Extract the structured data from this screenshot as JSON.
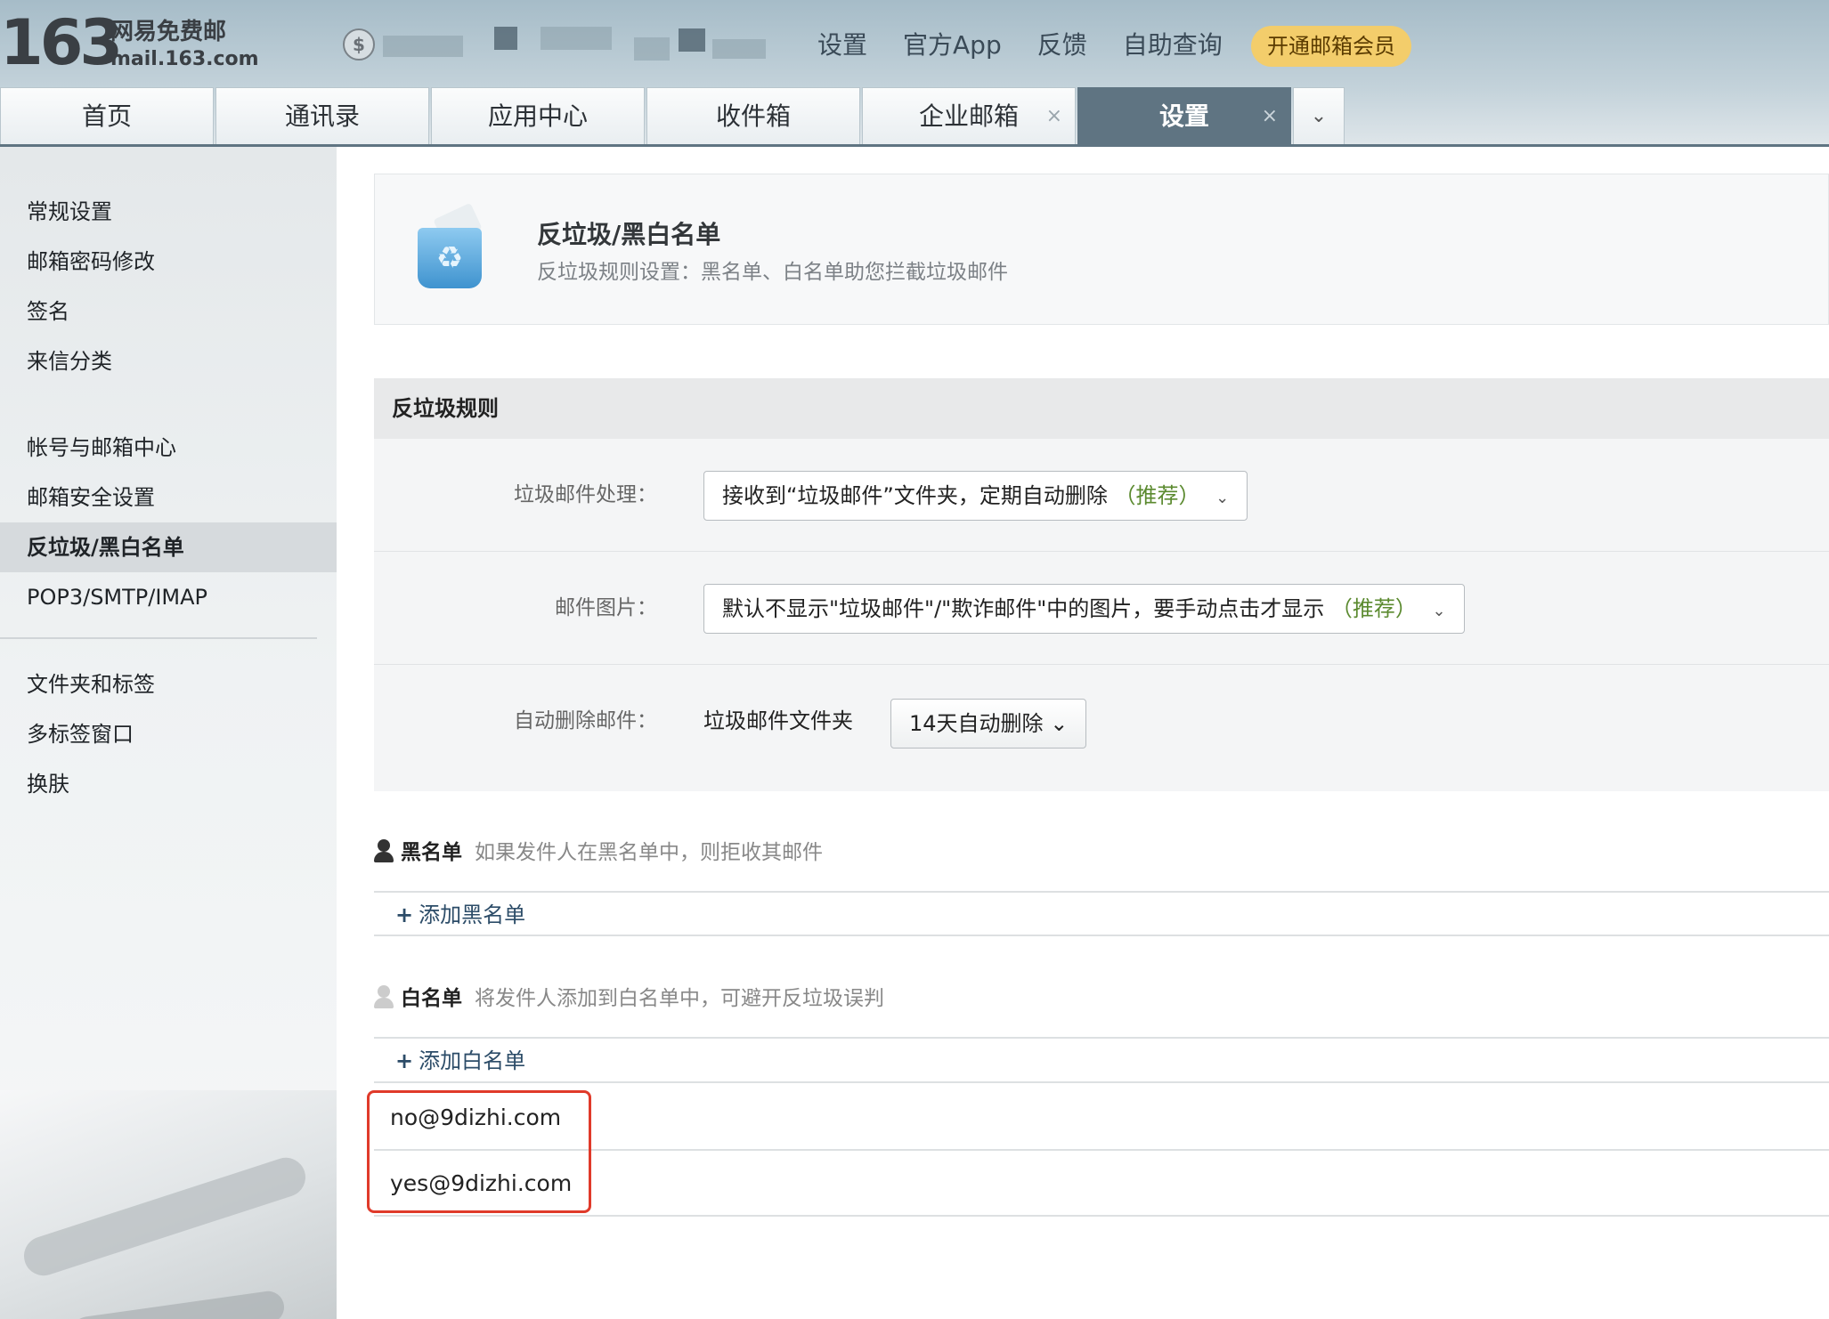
{
  "header": {
    "logo_number": "163",
    "logo_cn": "网易免费邮",
    "logo_en": "mail.163.com",
    "coin_symbol": "$",
    "links": [
      "设置",
      "官方App",
      "反馈",
      "自助查询"
    ],
    "vip_label": "开通邮箱会员"
  },
  "tabs": [
    {
      "label": "首页",
      "closable": false,
      "active": false
    },
    {
      "label": "通讯录",
      "closable": false,
      "active": false
    },
    {
      "label": "应用中心",
      "closable": false,
      "active": false
    },
    {
      "label": "收件箱",
      "closable": false,
      "active": false
    },
    {
      "label": "企业邮箱",
      "closable": true,
      "active": false
    },
    {
      "label": "设置",
      "closable": true,
      "active": true
    }
  ],
  "tab_close_symbol": "×",
  "tab_more_symbol": "⌄",
  "sidebar": {
    "items": [
      "常规设置",
      "邮箱密码修改",
      "签名",
      "来信分类",
      "帐号与邮箱中心",
      "邮箱安全设置",
      "反垃圾/黑白名单",
      "POP3/SMTP/IMAP",
      "文件夹和标签",
      "多标签窗口",
      "换肤"
    ],
    "active_index": 6
  },
  "banner": {
    "title": "反垃圾/黑白名单",
    "subtitle": "反垃圾规则设置：黑名单、白名单助您拦截垃圾邮件",
    "icon_symbol": "♻"
  },
  "rules": {
    "section_title": "反垃圾规则",
    "spam": {
      "label": "垃圾邮件处理：",
      "value": "接收到“垃圾邮件”文件夹，定期自动删除",
      "tag": "（推荐）"
    },
    "images": {
      "label": "邮件图片：",
      "value": "默认不显示\"垃圾邮件\"/\"欺诈邮件\"中的图片，要手动点击才显示",
      "tag": "（推荐）"
    },
    "autodelete": {
      "label": "自动删除邮件：",
      "folder": "垃圾邮件文件夹",
      "value": "14天自动删除"
    },
    "dropdown_arrow": "⌄"
  },
  "blacklist": {
    "title": "黑名单",
    "desc": "如果发件人在黑名单中，则拒收其邮件",
    "add_label": "添加黑名单",
    "icon_color": "#333333"
  },
  "whitelist": {
    "title": "白名单",
    "desc": "将发件人添加到白名单中，可避开反垃圾误判",
    "add_label": "添加白名单",
    "icon_color": "#cccccc",
    "entries": [
      "no@9dizhi.com",
      "yes@9dizhi.com"
    ]
  },
  "add_symbol": "+",
  "colors": {
    "tab_active": "#5f7482",
    "recommend": "#5b8a2f",
    "highlight_border": "#e03a2a",
    "vip_badge": "#f3cd6b"
  }
}
